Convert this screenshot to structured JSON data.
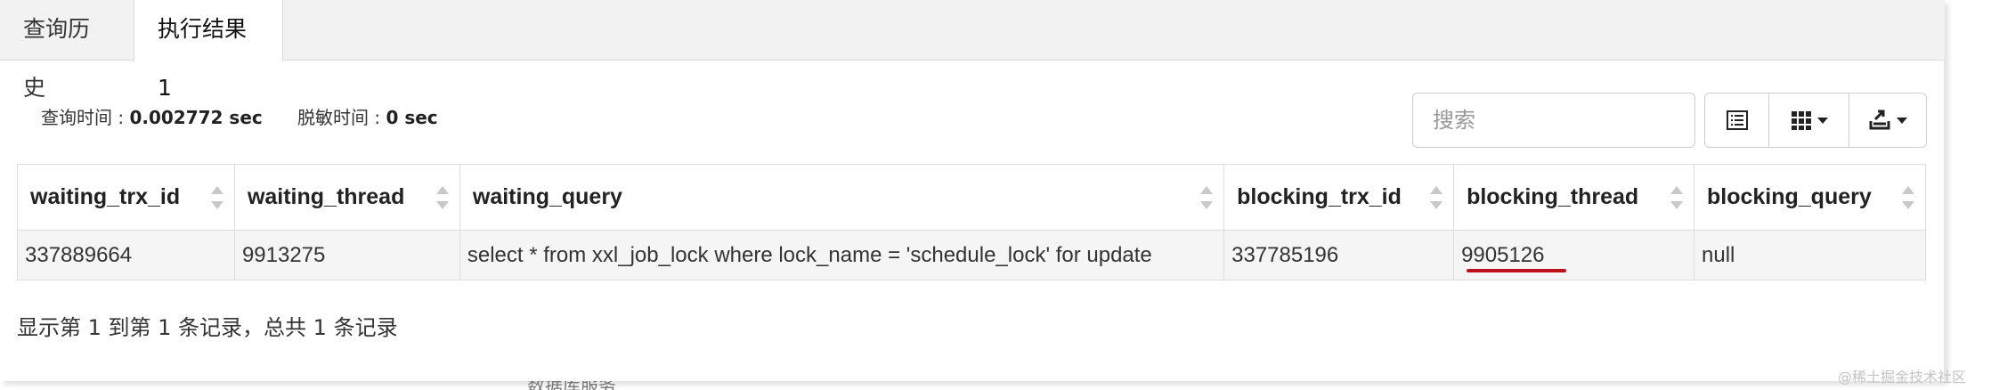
{
  "tabs": [
    {
      "label": "查询历史",
      "active": false
    },
    {
      "label": "执行结果1",
      "active": true
    }
  ],
  "timing": {
    "query_label": "查询时间 : ",
    "query_value": "0.002772 sec",
    "desensitize_label": "脱敏时间 : ",
    "desensitize_value": "0 sec"
  },
  "toolbar": {
    "search_placeholder": "搜索",
    "icons": [
      "list-view-icon",
      "columns-grid-icon",
      "export-icon"
    ]
  },
  "table": {
    "columns": [
      "waiting_trx_id",
      "waiting_thread",
      "waiting_query",
      "blocking_trx_id",
      "blocking_thread",
      "blocking_query"
    ],
    "rows": [
      [
        "337889664",
        "9913275",
        "select * from xxl_job_lock where lock_name = 'schedule_lock' for update",
        "337785196",
        "9905126",
        "null"
      ]
    ],
    "highlight": {
      "column": "blocking_thread",
      "row": 0,
      "color": "#c0111a"
    }
  },
  "footer": "显示第 1 到第 1 条记录，总共 1 条记录",
  "watermark": "@稀土掘金技术社区",
  "stray_text": "数据库服务"
}
